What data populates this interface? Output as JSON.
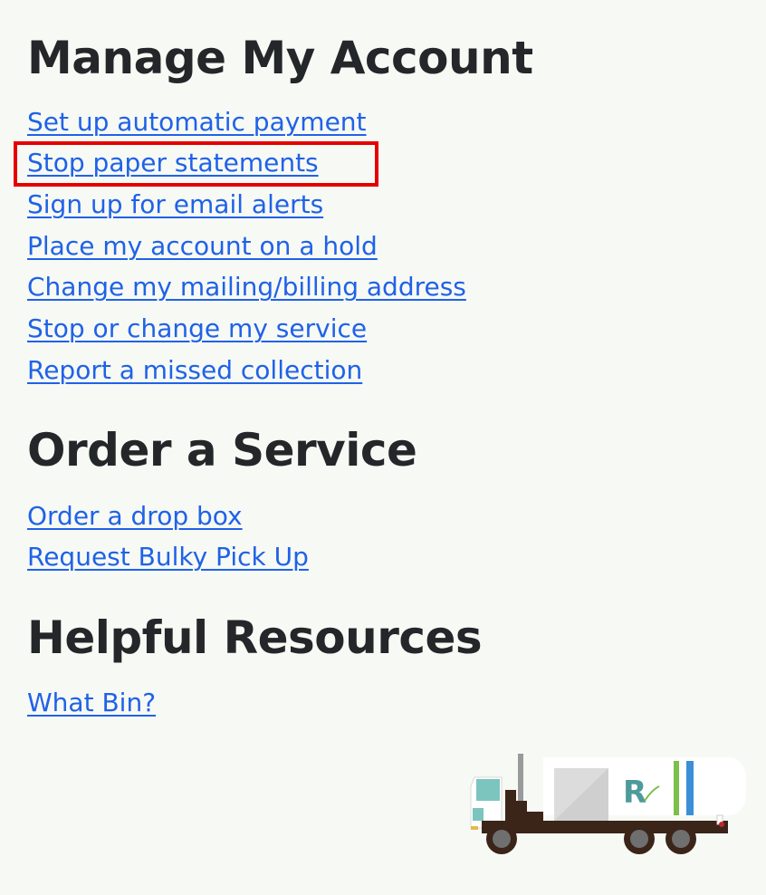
{
  "sections": [
    {
      "title": "Manage My Account",
      "links": [
        "Set up automatic payment",
        "Stop paper statements",
        "Sign up for email alerts",
        "Place my account on a hold",
        "Change my mailing/billing address",
        "Stop or change my service",
        "Report a missed collection"
      ]
    },
    {
      "title": "Order a Service",
      "links": [
        "Order a drop box",
        "Request Bulky Pick Up"
      ]
    },
    {
      "title": "Helpful Resources",
      "links": [
        "What Bin?"
      ]
    }
  ],
  "highlighted_link": "Stop paper statements",
  "colors": {
    "link": "#1f62e8",
    "heading": "#23272a",
    "highlight": "#e50000",
    "background": "#f7f9f4"
  },
  "icons": {
    "truck": "garbage-truck-icon"
  }
}
